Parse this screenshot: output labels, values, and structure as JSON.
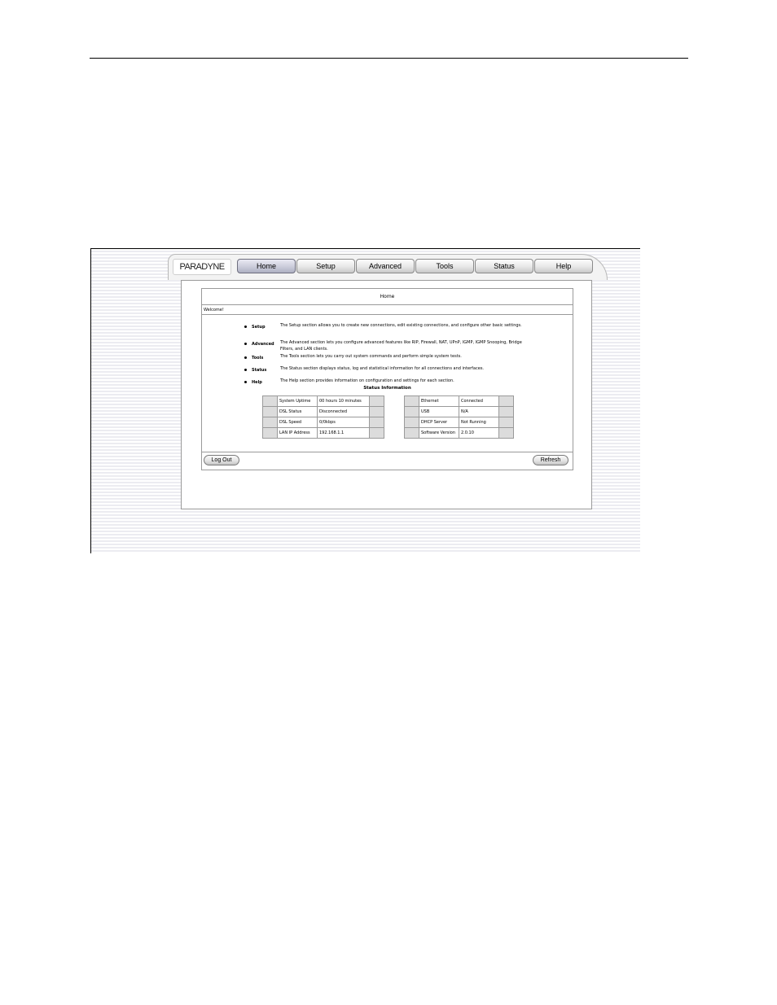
{
  "nav": {
    "logo": "PARADYNE",
    "tabs": [
      {
        "label": "Home",
        "active": true
      },
      {
        "label": "Setup"
      },
      {
        "label": "Advanced"
      },
      {
        "label": "Tools"
      },
      {
        "label": "Status"
      },
      {
        "label": "Help"
      }
    ]
  },
  "panel": {
    "title": "Home",
    "welcome": "Welcome!",
    "sections": [
      {
        "name": "Setup",
        "description": "The Setup section allows you to create new connections, edit existing connections, and configure other basic settings."
      },
      {
        "name": "Advanced",
        "description": "The Advanced section lets you configure advanced features like RIP, Firewall, NAT, UPnP, IGMP, IGMP Snooping, Bridge Filters, and LAN clients."
      },
      {
        "name": "Tools",
        "description": "The Tools section lets you carry out system commands and perform simple system tests."
      },
      {
        "name": "Status",
        "description": "The Status section displays status, log and statistical information for all connections and interfaces."
      },
      {
        "name": "Help",
        "description": "The Help section provides information on configuration and settings for each section."
      }
    ],
    "status_heading": "Status Information",
    "status_left": [
      {
        "label": "System Uptime",
        "value": "00 hours 10 minutes"
      },
      {
        "label": "DSL Status",
        "value": "Disconnected"
      },
      {
        "label": "DSL Speed",
        "value": "0/0kbps"
      },
      {
        "label": "LAN IP Address",
        "value": "192.168.1.1"
      }
    ],
    "status_right": [
      {
        "label": "Ethernet",
        "value": "Connected"
      },
      {
        "label": "USB",
        "value": "N/A"
      },
      {
        "label": "DHCP Server",
        "value": "Not Running"
      },
      {
        "label": "Software Version",
        "value": "2.0.10"
      }
    ],
    "logout_label": "Log Out",
    "refresh_label": "Refresh"
  }
}
